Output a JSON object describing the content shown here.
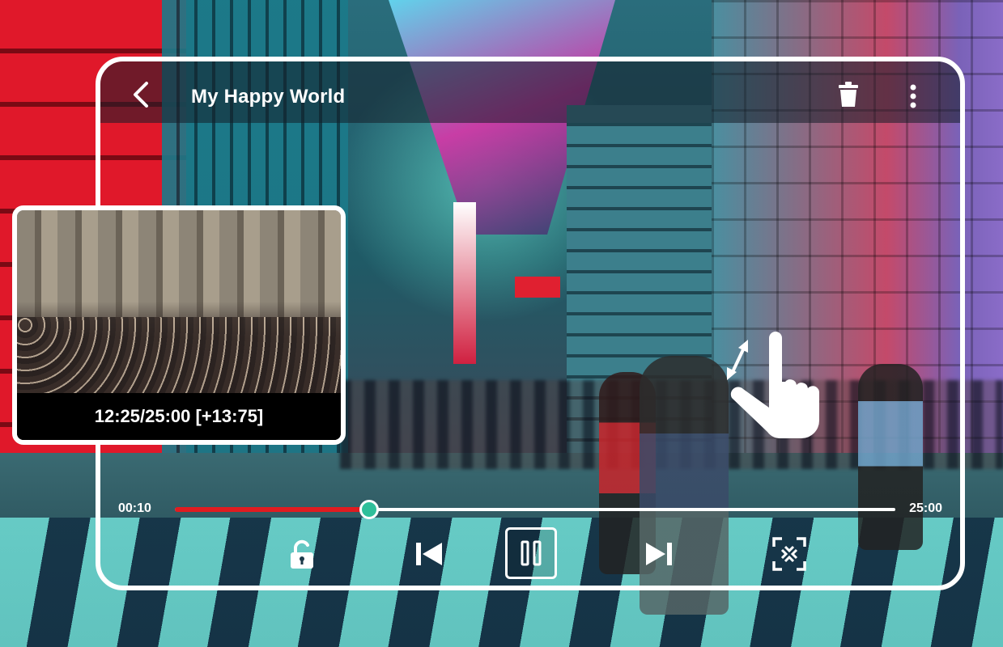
{
  "player": {
    "title": "My Happy World",
    "icons": {
      "back": "chevron-left-icon",
      "delete": "trash-icon",
      "more": "more-vertical-icon",
      "lock": "unlock-icon",
      "previous": "skip-previous-icon",
      "pause": "pause-icon",
      "next": "skip-next-icon",
      "fit": "fit-screen-icon",
      "gesture": "hand-tap-icon"
    },
    "progress": {
      "current_time": "00:10",
      "total_time": "25:00",
      "position_fraction": 0.27
    },
    "colors": {
      "progress_played": "#e01c20",
      "progress_remaining": "#ffffff",
      "thumb": "#2fbf9a",
      "frame": "#ffffff"
    }
  },
  "preview": {
    "caption": "12:25/25:00 [+13:75]"
  }
}
